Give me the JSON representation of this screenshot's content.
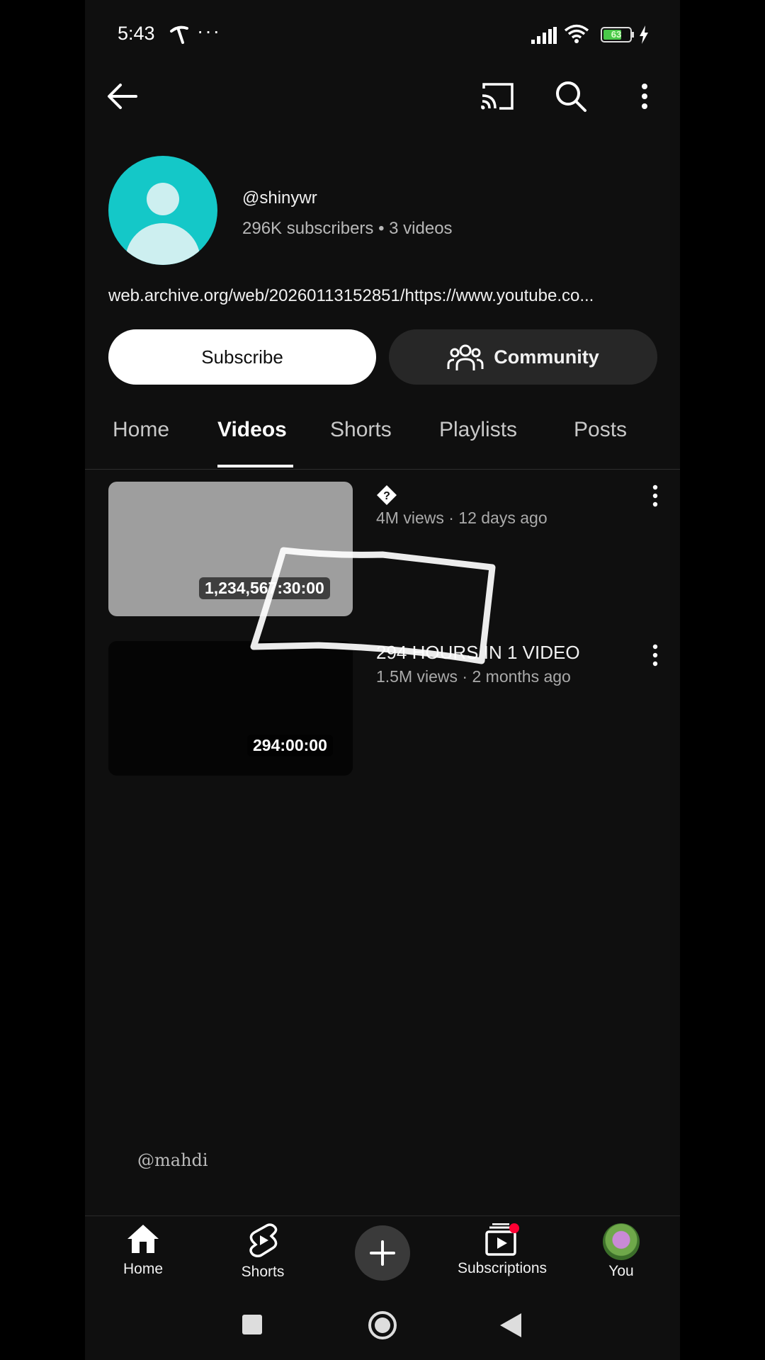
{
  "status_bar": {
    "time": "5:43",
    "more": "···",
    "battery_level": "63"
  },
  "channel": {
    "handle": "@shinywr",
    "stats": "296K subscribers • 3 videos",
    "link": "web.archive.org/web/20260113152851/https://www.youtube.co..."
  },
  "actions": {
    "subscribe": "Subscribe",
    "community": "Community"
  },
  "tabs": [
    {
      "label": "Home"
    },
    {
      "label": "Videos"
    },
    {
      "label": "Shorts"
    },
    {
      "label": "Playlists"
    },
    {
      "label": "Posts"
    }
  ],
  "videos": [
    {
      "title": "",
      "meta": "4M views · 12 days ago",
      "duration": "1,234,567:30:00",
      "thumb_color": "#9e9e9e"
    },
    {
      "title": "294 HOURS IN 1 VIDEO",
      "meta": "1.5M views · 2 months ago",
      "duration": "294:00:00",
      "thumb_color": "#050505"
    }
  ],
  "bottom_nav": {
    "home": "Home",
    "shorts": "Shorts",
    "subscriptions": "Subscriptions",
    "you": "You"
  },
  "watermark": "@mahdi",
  "colors": {
    "background": "#0f0f0f",
    "accent": "#ff0033",
    "avatar": "#14c8c8"
  }
}
